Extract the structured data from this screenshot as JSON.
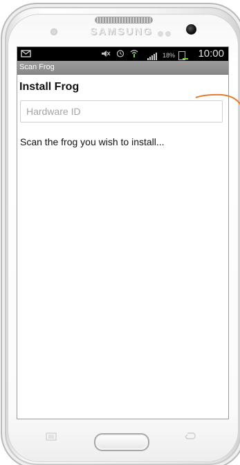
{
  "device": {
    "brand": "SAMSUNG"
  },
  "status_bar": {
    "time": "10:00",
    "battery_percent": "18%",
    "battery_level": 0.18,
    "icons": [
      "message-icon",
      "mute-icon",
      "alarm-icon",
      "wifi-icon",
      "signal-icon",
      "battery-icon"
    ]
  },
  "app": {
    "title": "Scan Frog"
  },
  "main": {
    "heading": "Install Frog",
    "hardware_input": {
      "placeholder": "Hardware ID",
      "value": ""
    },
    "instruction": "Scan the frog you wish to install..."
  },
  "colors": {
    "title_bar": "#8f8f8f",
    "status_bar": "#000000",
    "callout": "#e87a2a",
    "battery": "#6fd23f"
  }
}
